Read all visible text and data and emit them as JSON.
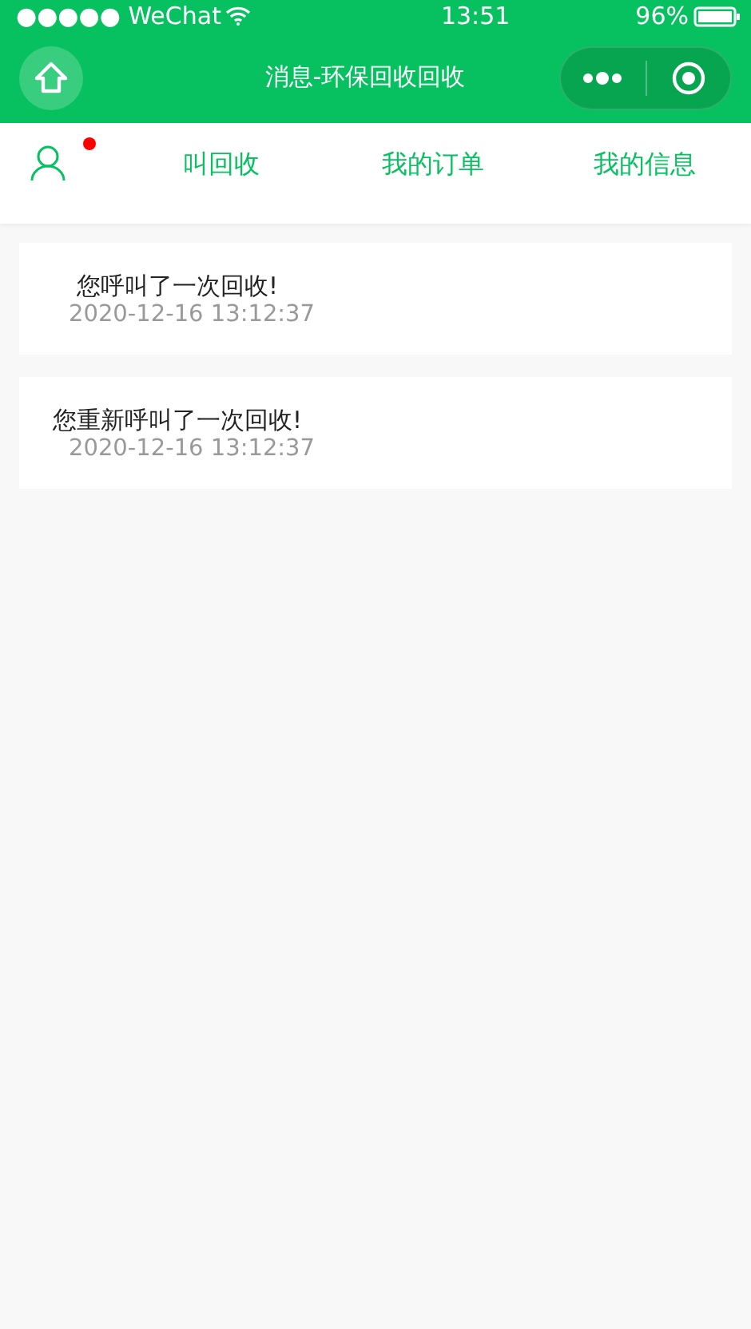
{
  "status_bar": {
    "carrier": "●●●●● WeChat",
    "time": "13:51",
    "battery": "96%"
  },
  "nav_bar": {
    "title": "消息-环保回收回收"
  },
  "top_tabs": {
    "profile_badge": true,
    "items": [
      {
        "label": "叫回收"
      },
      {
        "label": "我的订单"
      },
      {
        "label": "我的信息"
      }
    ]
  },
  "messages": [
    {
      "text": "您呼叫了一次回收!",
      "time": "2020-12-16 13:12:37"
    },
    {
      "text": "您重新呼叫了一次回收!",
      "time": "2020-12-16 13:12:37"
    }
  ]
}
